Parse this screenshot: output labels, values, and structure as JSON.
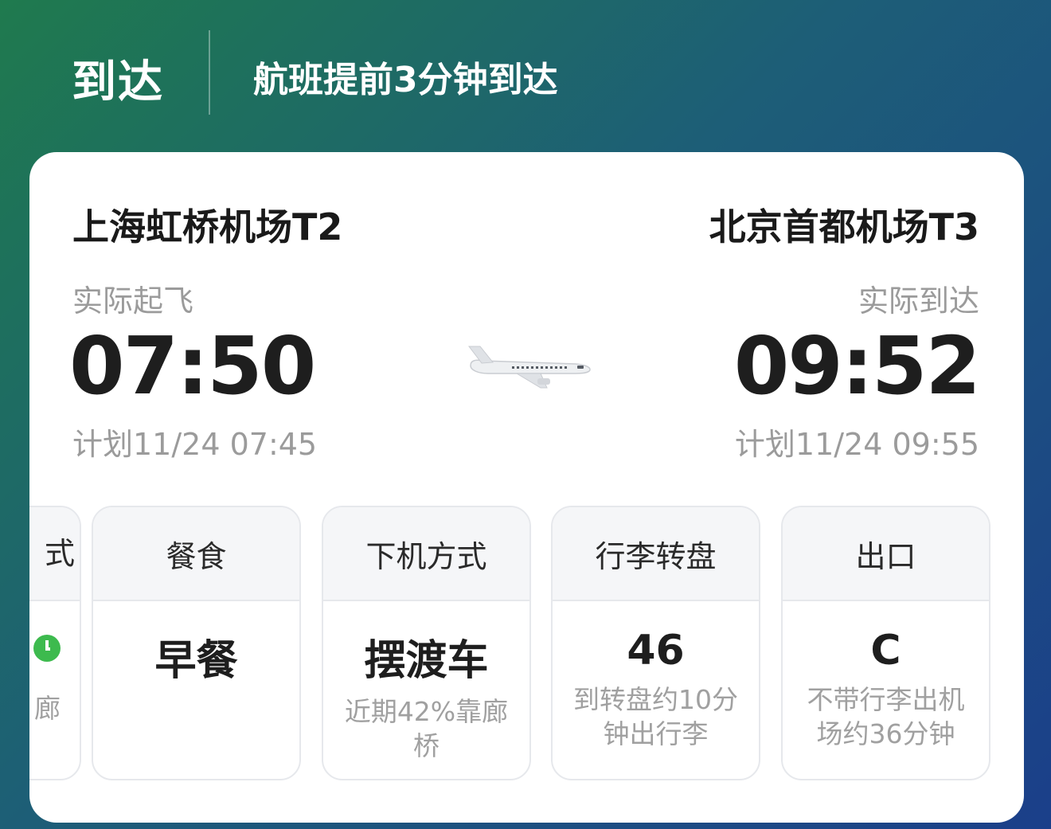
{
  "header": {
    "status": "到达",
    "note": "航班提前3分钟到达"
  },
  "departure": {
    "airport": "上海虹桥机场T2",
    "label": "实际起飞",
    "time": "07:50",
    "planned": "计划11/24 07:45"
  },
  "arrival": {
    "airport": "北京首都机场T3",
    "label": "实际到达",
    "time": "09:52",
    "planned": "计划11/24 09:55"
  },
  "plane_icon": "airplane-icon",
  "tiles": [
    {
      "title": "式",
      "value": "",
      "note": "廊",
      "icon": "check-circle-icon"
    },
    {
      "title": "餐食",
      "value": "早餐",
      "note": ""
    },
    {
      "title": "下机方式",
      "value": "摆渡车",
      "note": "近期42%靠廊桥"
    },
    {
      "title": "行李转盘",
      "value": "46",
      "note": "到转盘约10分钟出行李"
    },
    {
      "title": "出口",
      "value": "C",
      "note": "不带行李出机场约36分钟"
    }
  ],
  "colors": {
    "gradient_start": "#1f7a4e",
    "gradient_end": "#1b3f8a",
    "accent_green": "#3dba4e"
  }
}
